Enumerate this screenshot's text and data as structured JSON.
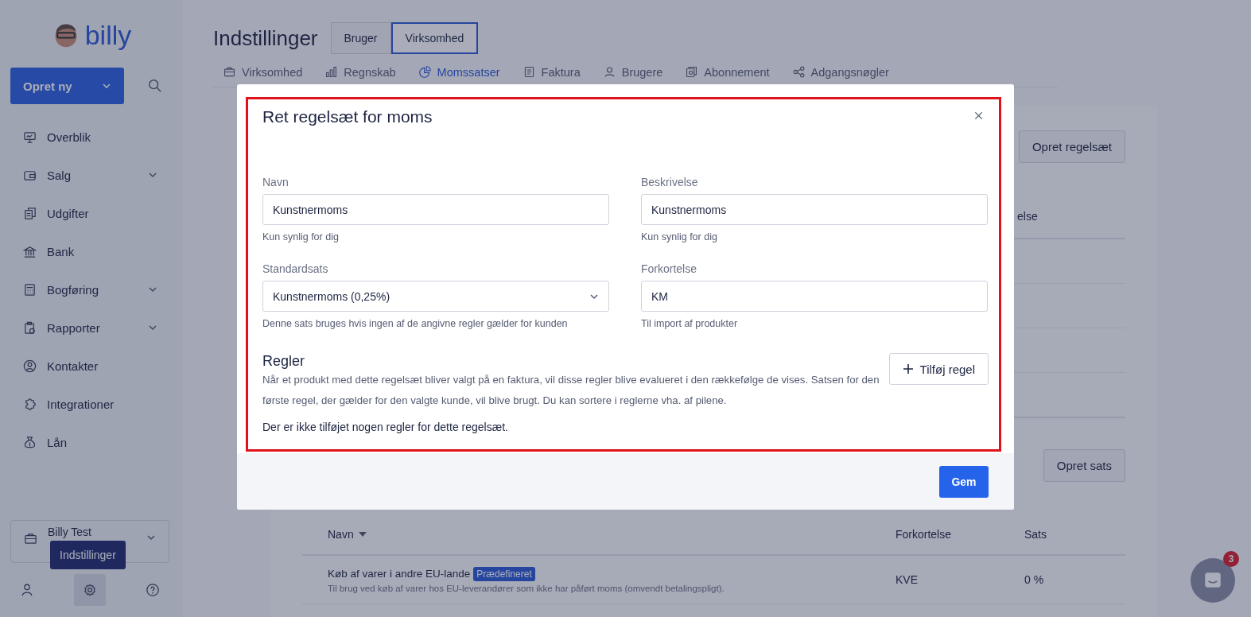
{
  "sidebar": {
    "logo": "billy",
    "create_button": "Opret ny",
    "nav": [
      {
        "label": "Overblik",
        "expandable": false
      },
      {
        "label": "Salg",
        "expandable": true
      },
      {
        "label": "Udgifter",
        "expandable": false
      },
      {
        "label": "Bank",
        "expandable": false
      },
      {
        "label": "Bogføring",
        "expandable": true
      },
      {
        "label": "Rapporter",
        "expandable": true
      },
      {
        "label": "Kontakter",
        "expandable": false
      },
      {
        "label": "Integrationer",
        "expandable": false
      },
      {
        "label": "Lån",
        "expandable": false
      }
    ],
    "company": {
      "name": "Billy Test"
    },
    "tooltip": "Indstillinger"
  },
  "header": {
    "title": "Indstillinger",
    "toggle": [
      {
        "label": "Bruger",
        "selected": false
      },
      {
        "label": "Virksomhed",
        "selected": true
      }
    ],
    "tabs": [
      {
        "label": "Virksomhed",
        "selected": false
      },
      {
        "label": "Regnskab",
        "selected": false
      },
      {
        "label": "Momssatser",
        "selected": true
      },
      {
        "label": "Faktura",
        "selected": false
      },
      {
        "label": "Brugere",
        "selected": false
      },
      {
        "label": "Abonnement",
        "selected": false
      },
      {
        "label": "Adgangsnøgler",
        "selected": false
      }
    ]
  },
  "background": {
    "create_ruleset_button": "Opret regelsæt",
    "ruleset_table": {
      "column_3": "else"
    },
    "create_rate_button": "Opret sats",
    "rates_table": {
      "columns": [
        "Navn",
        "Forkortelse",
        "Sats"
      ],
      "rows": [
        {
          "name": "Køb af varer i andre EU-lande",
          "badge": "Prædefineret",
          "description": "Til brug ved køb af varer hos EU-leverandører som ikke har påført moms (omvendt betalingspligt).",
          "abbreviation": "KVE",
          "rate": "0 %"
        }
      ]
    }
  },
  "dialog": {
    "title": "Ret regelsæt for moms",
    "fields": [
      {
        "label": "Navn",
        "kind": "text",
        "value": "Kunstnermoms",
        "hint": "Kun synlig for dig"
      },
      {
        "label": "Beskrivelse",
        "kind": "text",
        "value": "Kunstnermoms",
        "hint": "Kun synlig for dig"
      },
      {
        "label": "Standardsats",
        "kind": "select",
        "value": "Kunstnermoms (0,25%)",
        "hint": "Denne sats bruges hvis ingen af de angivne regler gælder for kunden"
      },
      {
        "label": "Forkortelse",
        "kind": "text",
        "value": "KM",
        "hint": "Til import af produkter"
      }
    ],
    "rules": {
      "heading": "Regler",
      "description": "Når et produkt med dette regelsæt bliver valgt på en faktura, vil disse regler blive evalueret i den rækkefølge de vises. Satsen for den første regel, der gælder for den valgte kunde, vil blive brugt. Du kan sortere i reglerne vha. af pilene.",
      "add_button": "Tilføj regel",
      "empty_text": "Der er ikke tilføjet nogen regler for dette regelsæt."
    },
    "save_button": "Gem"
  },
  "chat": {
    "badge": "3"
  }
}
